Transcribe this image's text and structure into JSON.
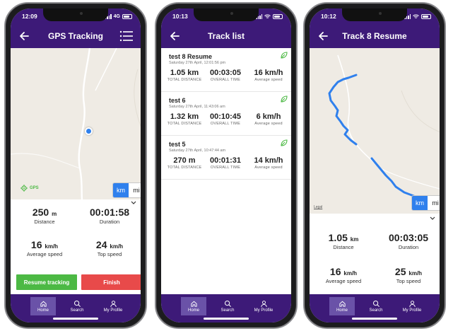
{
  "colors": {
    "brand": "#3d1a78",
    "accent": "#2f80ed",
    "resume": "#4cb944",
    "finish": "#e84a4a",
    "map_bg": "#efebe4"
  },
  "phones": [
    {
      "time": "12:09",
      "network": "4G",
      "title": "GPS Tracking",
      "gps_label": "GPS",
      "unit_km": "km",
      "unit_mi": "mi",
      "stats": {
        "distance": {
          "value": "250",
          "unit": "m",
          "label": "Distance"
        },
        "duration": {
          "value": "00:01:58",
          "label": "Duration"
        },
        "avg_speed": {
          "value": "16",
          "unit": "km/h",
          "label": "Average speed"
        },
        "top_speed": {
          "value": "24",
          "unit": "km/h",
          "label": "Top speed"
        }
      },
      "resume_label": "Resume tracking",
      "finish_label": "Finish"
    },
    {
      "time": "10:13",
      "title": "Track list",
      "tracks": [
        {
          "name": "test 8 Resume",
          "date": "Saturday 27th April, 12:01:56 pm",
          "distance": "1.05 km",
          "time": "00:03:05",
          "speed": "16 km/h"
        },
        {
          "name": "test 6",
          "date": "Saturday 27th April, 11:43:06 am",
          "distance": "1.32 km",
          "time": "00:10:45",
          "speed": "6 km/h"
        },
        {
          "name": "test 5",
          "date": "Saturday 27th April, 10:47:44 am",
          "distance": "270 m",
          "time": "00:01:31",
          "speed": "14 km/h"
        }
      ],
      "col_labels": {
        "distance": "TOTAL DISTANCE",
        "time": "OVERALL TIME",
        "speed": "Average speed"
      }
    },
    {
      "time": "10:12",
      "title": "Track 8 Resume",
      "legal": "Legal",
      "unit_km": "km",
      "unit_mi": "mi",
      "stats": {
        "distance": {
          "value": "1.05",
          "unit": "km",
          "label": "Distance"
        },
        "duration": {
          "value": "00:03:05",
          "label": "Duration"
        },
        "avg_speed": {
          "value": "16",
          "unit": "km/h",
          "label": "Average speed"
        },
        "top_speed": {
          "value": "25",
          "unit": "km/h",
          "label": "Top speed"
        }
      }
    }
  ],
  "nav": {
    "home": "Home",
    "search": "Search",
    "profile": "My Profile"
  }
}
